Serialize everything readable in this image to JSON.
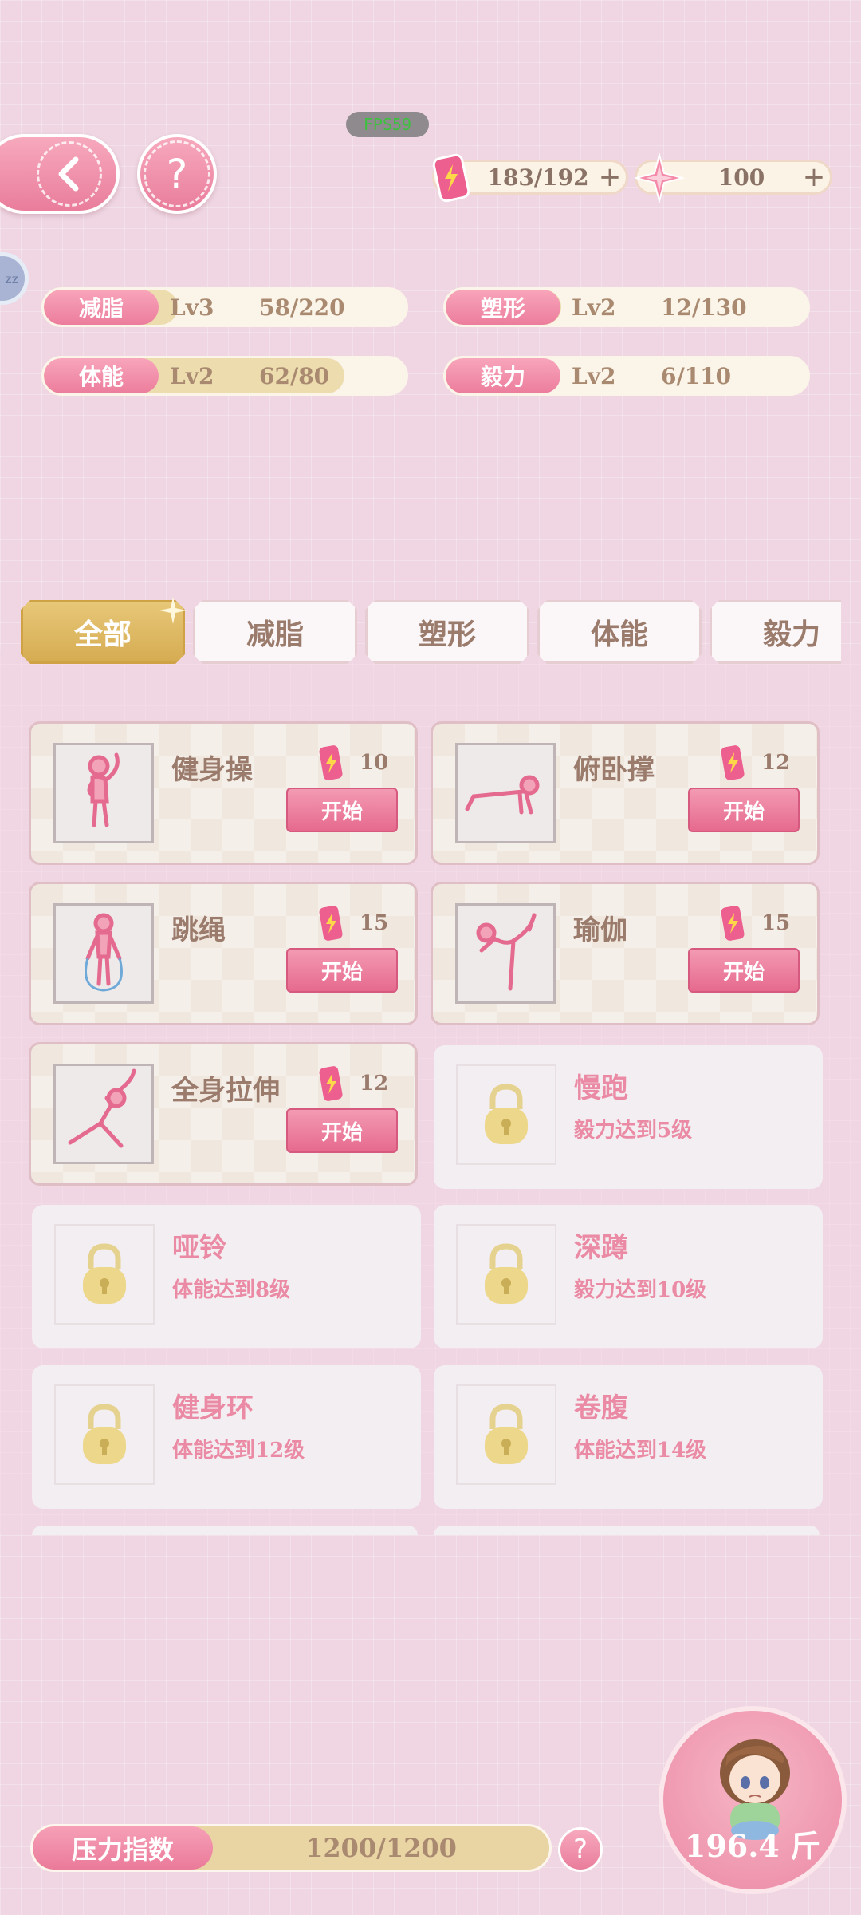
{
  "overlay": {
    "fps": "FPS59"
  },
  "header": {
    "back": "back",
    "help": "?",
    "energy": {
      "value": "183/192",
      "plus": "+"
    },
    "gems": {
      "value": "100",
      "plus": "+"
    },
    "side_bubble": "zz"
  },
  "stats": [
    {
      "name": "减脂",
      "level": "Lv3",
      "progress": "58/220",
      "fill": 0.26
    },
    {
      "name": "塑形",
      "level": "Lv2",
      "progress": "12/130",
      "fill": 0.09
    },
    {
      "name": "体能",
      "level": "Lv2",
      "progress": "62/80",
      "fill": 0.78
    },
    {
      "name": "毅力",
      "level": "Lv2",
      "progress": "6/110",
      "fill": 0.05
    }
  ],
  "tabs": [
    {
      "label": "全部",
      "active": true
    },
    {
      "label": "减脂"
    },
    {
      "label": "塑形"
    },
    {
      "label": "体能"
    },
    {
      "label": "毅力"
    }
  ],
  "exercises": [
    {
      "name": "健身操",
      "cost": "10",
      "button": "开始"
    },
    {
      "name": "俯卧撑",
      "cost": "12",
      "button": "开始"
    },
    {
      "name": "跳绳",
      "cost": "15",
      "button": "开始"
    },
    {
      "name": "瑜伽",
      "cost": "15",
      "button": "开始"
    },
    {
      "name": "全身拉伸",
      "cost": "12",
      "button": "开始"
    },
    {
      "name": "慢跑",
      "requirement": "毅力达到5级"
    },
    {
      "name": "哑铃",
      "requirement": "体能达到8级"
    },
    {
      "name": "深蹲",
      "requirement": "毅力达到10级"
    },
    {
      "name": "健身环",
      "requirement": "体能达到12级"
    },
    {
      "name": "卷腹",
      "requirement": "体能达到14级"
    }
  ],
  "footer": {
    "pressure_label": "压力指数",
    "pressure_value": "1200/1200",
    "pressure_fill": 1.0,
    "help": "?",
    "weight": "196.4 斤"
  },
  "colors": {
    "pink": "#ec7d9c",
    "gold": "#d6ac52",
    "beige": "#fbf4e8",
    "text_brown": "#9a7b6c"
  }
}
